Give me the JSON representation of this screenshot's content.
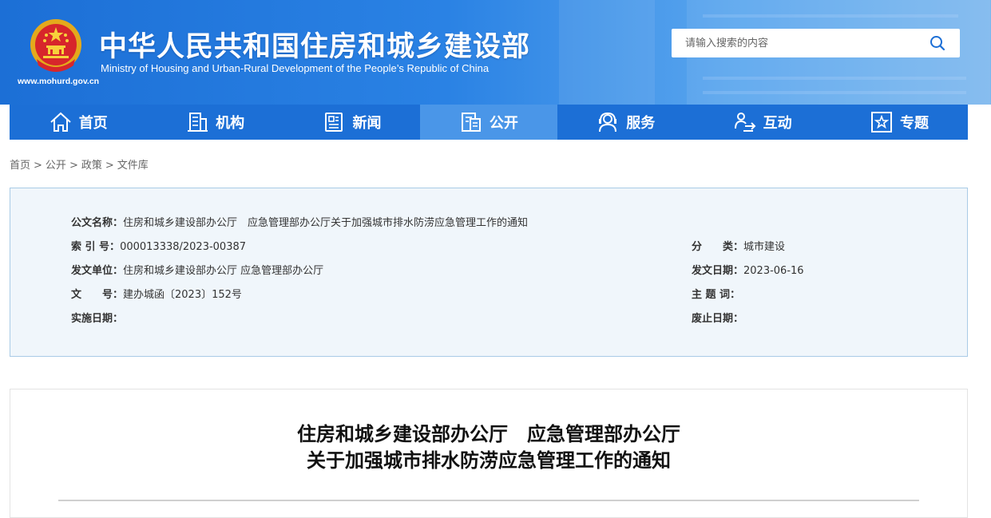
{
  "header": {
    "title_cn": "中华人民共和国住房和城乡建设部",
    "title_en": "Ministry of Housing and Urban-Rural Development of the People’s Republic of China",
    "url": "www.mohurd.gov.cn",
    "search_placeholder": "请输入搜索的内容",
    "colors": {
      "brand_blue": "#1c6fd6",
      "nav_active": "#4a96e8"
    }
  },
  "nav": {
    "items": [
      {
        "label": "首页",
        "icon": "home-icon"
      },
      {
        "label": "机构",
        "icon": "building-icon"
      },
      {
        "label": "新闻",
        "icon": "news-icon"
      },
      {
        "label": "公开",
        "icon": "document-icon",
        "active": true
      },
      {
        "label": "服务",
        "icon": "service-icon"
      },
      {
        "label": "互动",
        "icon": "interaction-icon"
      },
      {
        "label": "专题",
        "icon": "star-icon"
      }
    ]
  },
  "breadcrumb": [
    "首页",
    "公开",
    "政策",
    "文件库"
  ],
  "info": {
    "doc_name_label": "公文名称：",
    "doc_name": "住房和城乡建设部办公厅　应急管理部办公厅关于加强城市排水防涝应急管理工作的通知",
    "index_label": "索 引 号：",
    "index": "000013338/2023-00387",
    "category_label": "分　　类：",
    "category": "城市建设",
    "issuer_label": "发文单位：",
    "issuer": "住房和城乡建设部办公厅 应急管理部办公厅",
    "issue_date_label": "发文日期：",
    "issue_date": "2023-06-16",
    "doc_no_label": "文　　号：",
    "doc_no": "建办城函〔2023〕152号",
    "keywords_label": "主 题 词：",
    "keywords": "",
    "effective_label": "实施日期：",
    "effective": "",
    "expire_label": "废止日期：",
    "expire": ""
  },
  "article": {
    "title_line1": "住房和城乡建设部办公厅　应急管理部办公厅",
    "title_line2": "关于加强城市排水防涝应急管理工作的通知"
  }
}
